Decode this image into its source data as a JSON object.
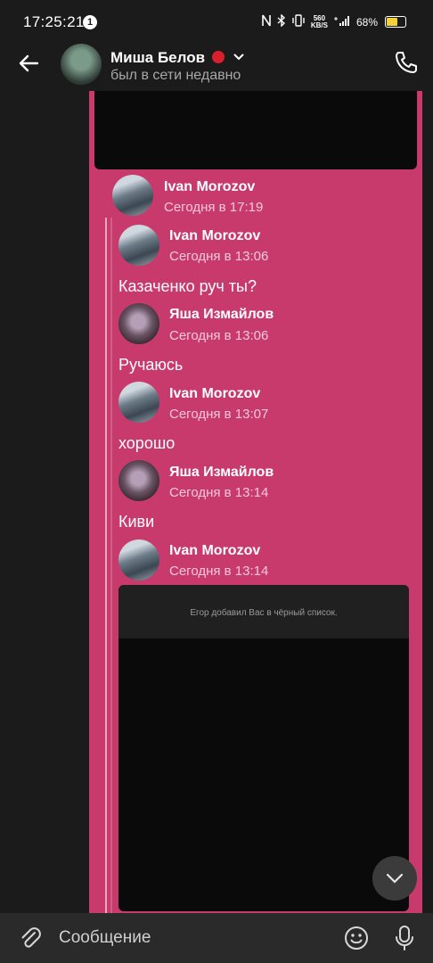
{
  "status_bar": {
    "time": "17:25:21",
    "notification_count": "1",
    "net_speed_value": "560",
    "net_speed_unit": "KB/S",
    "battery": "68%",
    "battery_level": 0.68,
    "battery_color": "#f2d23a"
  },
  "header": {
    "contact_name": "Миша Белов",
    "contact_status": "был в сети недавно"
  },
  "messages": [
    {
      "author": "Ivan Morozov",
      "time": "Сегодня в 17:19"
    },
    {
      "author": "Ivan Morozov",
      "time": "Сегодня в 13:06",
      "text": "Казаченко руч ты?"
    },
    {
      "author": "Яша Измайлов",
      "time": "Сегодня в 13:06",
      "text": "Ручаюсь"
    },
    {
      "author": "Ivan Morozov",
      "time": "Сегодня в 13:07",
      "text": "хорошо"
    },
    {
      "author": "Яша Измайлов",
      "time": "Сегодня в 13:14",
      "text": "Киви"
    },
    {
      "author": "Ivan Morozov",
      "time": "Сегодня в 13:14"
    }
  ],
  "media_caption": "Егор добавил Вас в чёрный список.",
  "composer": {
    "placeholder": "Сообщение"
  },
  "colors": {
    "forward_bg": "#c93a6c",
    "app_bg": "#1b1b1b"
  }
}
